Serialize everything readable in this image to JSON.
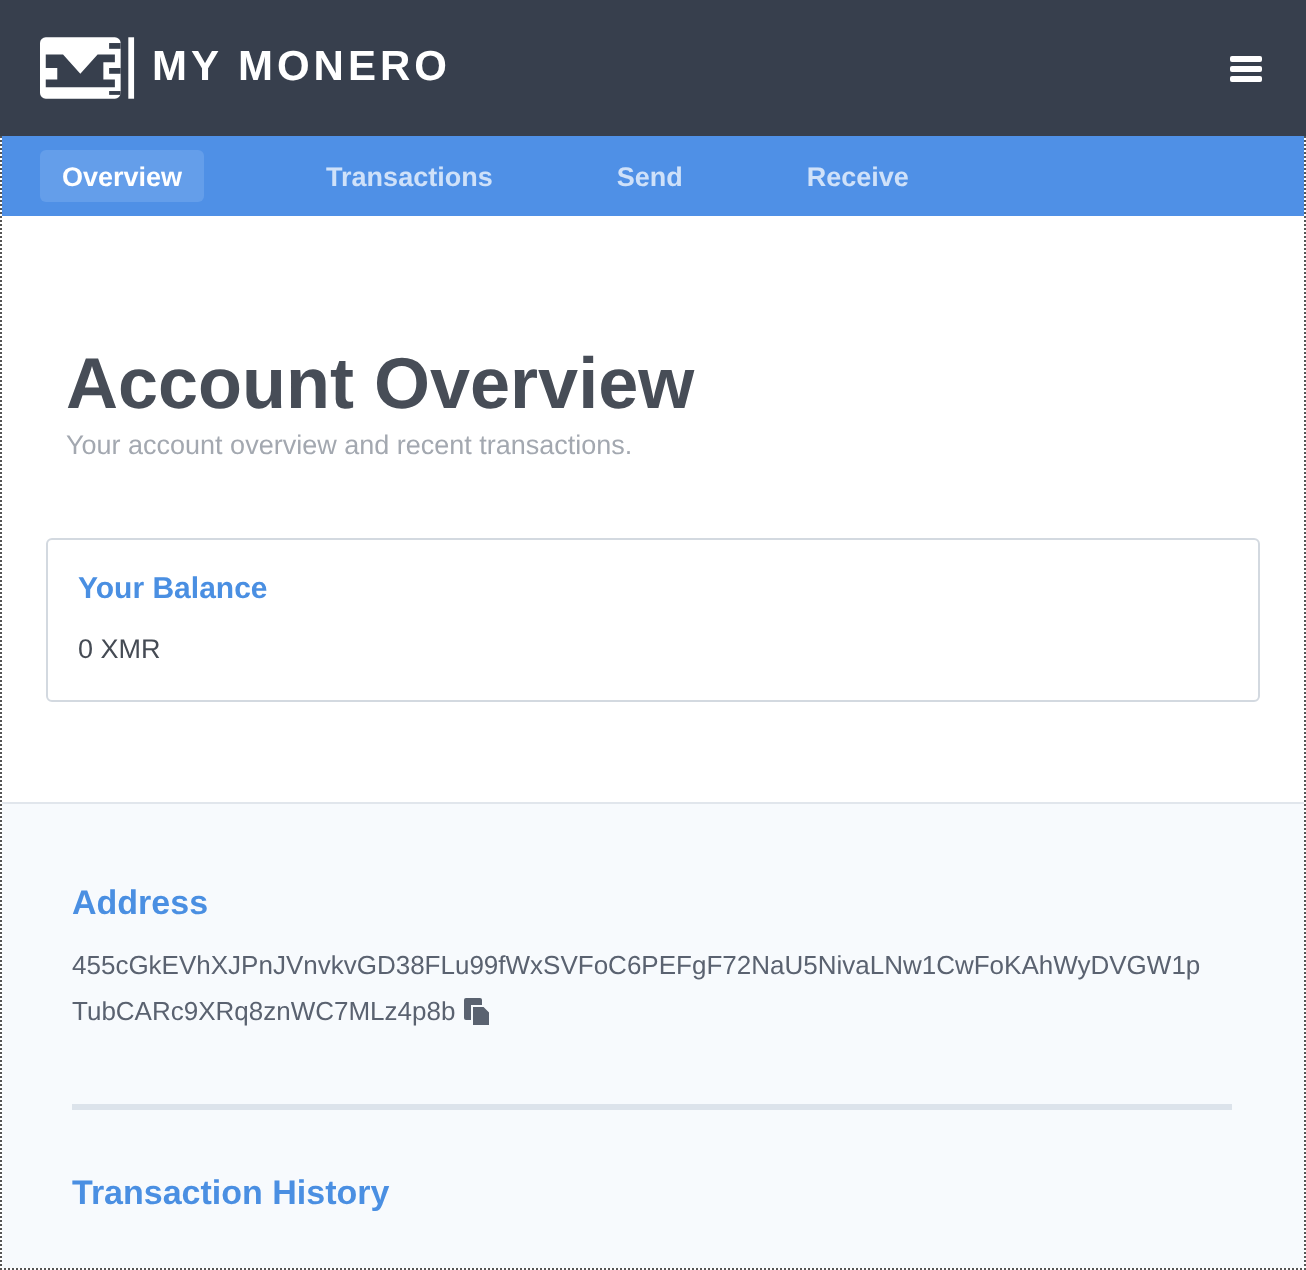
{
  "header": {
    "brand": "MY MONERO"
  },
  "tabs": [
    {
      "label": "Overview",
      "selected": true
    },
    {
      "label": "Transactions",
      "selected": false
    },
    {
      "label": "Send",
      "selected": false
    },
    {
      "label": "Receive",
      "selected": false
    }
  ],
  "page": {
    "title": "Account Overview",
    "subtitle": "Your account overview and recent transactions."
  },
  "balance": {
    "label": "Your Balance",
    "value": "0 XMR"
  },
  "address": {
    "heading": "Address",
    "lines": [
      "455cGkEVhXJPnJVnvkvGD38FLu99fWxSVFoC6PEFgF72NaU5NivaLNw1CwFoKAhWyDVGW1p",
      "TubCARc9XRq8znWC7MLz4p8b"
    ]
  },
  "history": {
    "heading": "Transaction History"
  }
}
